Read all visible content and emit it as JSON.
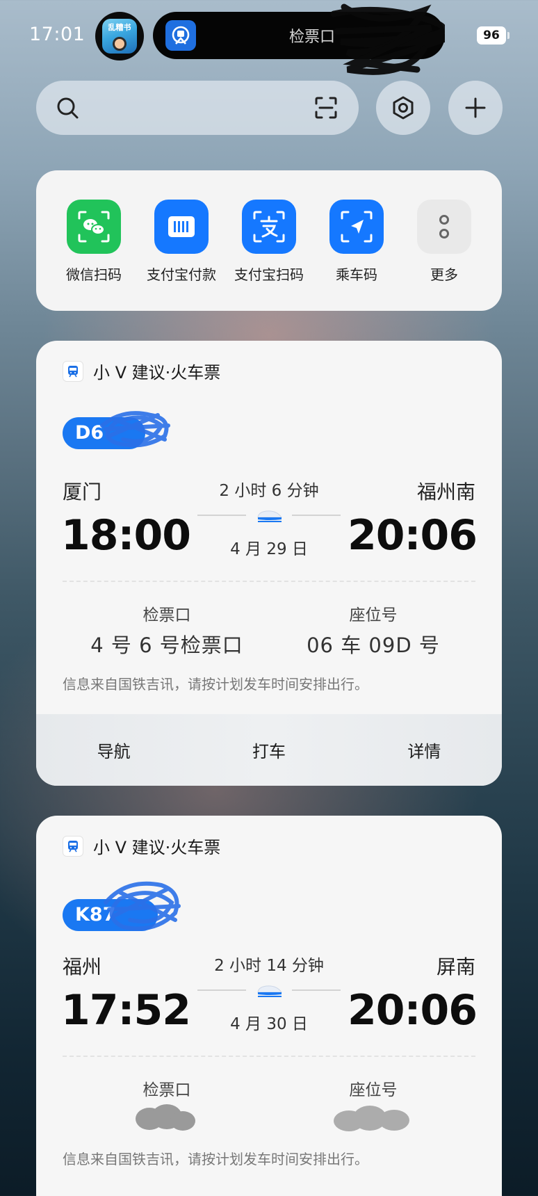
{
  "status_bar": {
    "time": "17:01",
    "app_badge_text": "乱糟书",
    "island_text": "检票口",
    "battery": "96"
  },
  "colors": {
    "wechat_green": "#21c35a",
    "alipay_blue": "#1578ff",
    "train_pill_blue": "#1a78f2"
  },
  "shortcuts": [
    {
      "label": "微信扫码",
      "icon": "wechat-scan-icon"
    },
    {
      "label": "支付宝付款",
      "icon": "alipay-pay-icon"
    },
    {
      "label": "支付宝扫码",
      "icon": "alipay-scan-icon"
    },
    {
      "label": "乘车码",
      "icon": "ride-code-icon"
    },
    {
      "label": "更多",
      "icon": "more-icon"
    }
  ],
  "tickets": [
    {
      "header": "小 V 建议·火车票",
      "train_no": "D6",
      "from_station": "厦门",
      "to_station": "福州南",
      "depart_time": "18:00",
      "arrive_time": "20:06",
      "duration": "2 小时 6 分钟",
      "date": "4 月 29 日",
      "gate_label": "检票口",
      "gate_value": "4 号 6 号检票口",
      "seat_label": "座位号",
      "seat_value": "06 车 09D 号",
      "note": "信息来自国铁吉讯，请按计划发车时间安排出行。",
      "actions": [
        "导航",
        "打车",
        "详情"
      ]
    },
    {
      "header": "小 V 建议·火车票",
      "train_no": "K87",
      "from_station": "福州",
      "to_station": "屏南",
      "depart_time": "17:52",
      "arrive_time": "20:06",
      "duration": "2 小时 14 分钟",
      "date": "4 月 30 日",
      "gate_label": "检票口",
      "seat_label": "座位号",
      "note": "信息来自国铁吉讯，请按计划发车时间安排出行。"
    }
  ]
}
